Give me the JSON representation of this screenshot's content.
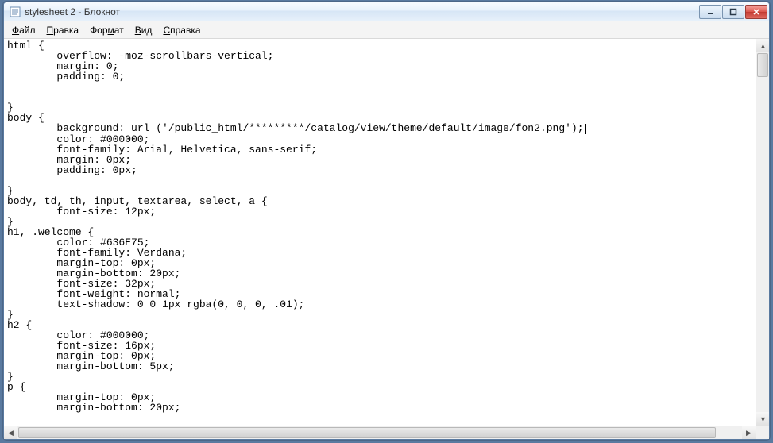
{
  "window": {
    "title": "stylesheet 2 - Блокнот",
    "icon_name": "notepad-icon"
  },
  "menu": {
    "file": {
      "hotkey": "Ф",
      "rest": "айл"
    },
    "edit": {
      "hotkey": "П",
      "rest": "равка"
    },
    "format": {
      "pre": "Фор",
      "hotkey": "м",
      "rest": "ат"
    },
    "view": {
      "hotkey": "В",
      "rest": "ид"
    },
    "help": {
      "hotkey": "С",
      "rest": "правка"
    }
  },
  "editor": {
    "lines": [
      "html {",
      "        overflow: -moz-scrollbars-vertical;",
      "        margin: 0;",
      "        padding: 0;",
      "",
      "",
      "}",
      "body {",
      "        background: url ('/public_html/*********/catalog/view/theme/default/image/fon2.png');",
      "        color: #000000;",
      "        font-family: Arial, Helvetica, sans-serif;",
      "        margin: 0px;",
      "        padding: 0px;",
      "",
      "}",
      "body, td, th, input, textarea, select, a {",
      "        font-size: 12px;",
      "}",
      "h1, .welcome {",
      "        color: #636E75;",
      "        font-family: Verdana;",
      "        margin-top: 0px;",
      "        margin-bottom: 20px;",
      "        font-size: 32px;",
      "        font-weight: normal;",
      "        text-shadow: 0 0 1px rgba(0, 0, 0, .01);",
      "}",
      "h2 {",
      "        color: #000000;",
      "        font-size: 16px;",
      "        margin-top: 0px;",
      "        margin-bottom: 5px;",
      "}",
      "p {",
      "        margin-top: 0px;",
      "        margin-bottom: 20px;"
    ],
    "caret_line_index": 8
  }
}
